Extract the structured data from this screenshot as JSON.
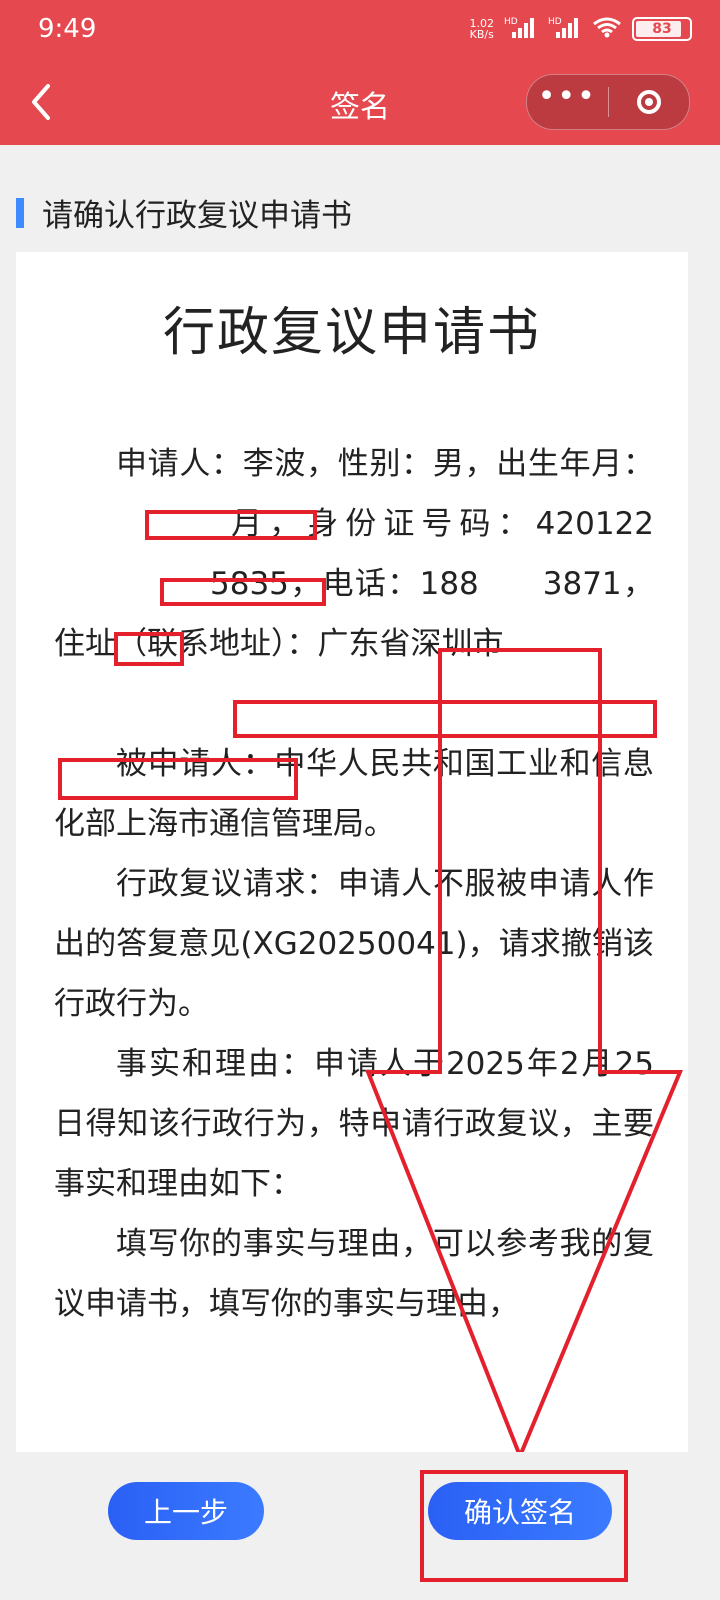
{
  "status_bar": {
    "time": "9:49",
    "net_speed_value": "1.02",
    "net_speed_unit": "KB/s",
    "hd1": "HD",
    "hd2": "HD",
    "battery": "83"
  },
  "nav": {
    "title": "签名",
    "capsule_more_icon": "more-dots-icon",
    "capsule_close_icon": "target-close-icon"
  },
  "section": {
    "title": "请确认行政复议申请书"
  },
  "document": {
    "title": "行政复议申请书",
    "p1": {
      "a": "申请人：李波，性别：男，出生年月：",
      "b": "月，身份证号码：",
      "id_prefix": "420122",
      "id_suffix": "5835",
      "c": "，电话：",
      "phone_prefix": "188",
      "phone_suffix": "3871",
      "d": "，住址（联系地址）：广东省深圳市"
    },
    "p2": "被申请人：中华人民共和国工业和信息化部上海市通信管理局。",
    "p3": "行政复议请求：申请人不服被申请人作出的答复意见(XG20250041)，请求撤销该行政行为。",
    "p4": "事实和理由：申请人于2025年2月25日得知该行政行为，特申请行政复议，主要事实和理由如下：",
    "p5": "填写你的事实与理由，可以参考我的复议申请书，填写你的事实与理由，"
  },
  "buttons": {
    "prev": "上一步",
    "confirm": "确认签名"
  },
  "colors": {
    "header": "#e5484f",
    "accent": "#3d8bff",
    "button": "#2f6bff",
    "annotation": "#e3202c"
  }
}
